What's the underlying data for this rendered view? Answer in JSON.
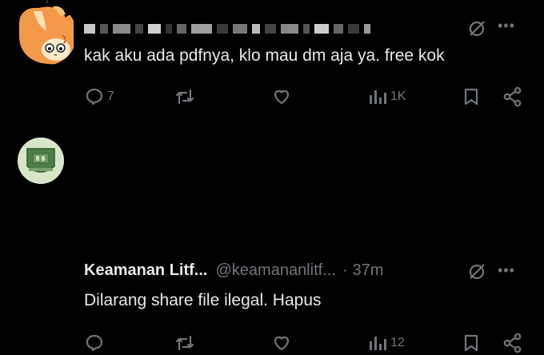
{
  "reply_tweet": {
    "author_redacted": true,
    "text": "kak aku ada pdfnya, klo mau dm aja ya. free kok",
    "actions": {
      "reply_count": "7",
      "views_count": "1K"
    }
  },
  "main_tweet": {
    "display_name": "Keamanan Litf...",
    "handle": "@keamananlitf...",
    "separator": "·",
    "time": "37m",
    "text": "Dilarang share file ilegal. Hapus",
    "actions": {
      "views_count": "12"
    }
  },
  "icons": {
    "reply": "reply-icon",
    "retweet": "retweet-icon",
    "like": "like-icon",
    "views": "views-icon",
    "bookmark": "bookmark-icon",
    "share": "share-icon",
    "grok": "grok-icon",
    "more": "more-icon"
  },
  "colors": {
    "background": "#000000",
    "text_primary": "#e7e9ea",
    "text_secondary": "#71767b"
  }
}
